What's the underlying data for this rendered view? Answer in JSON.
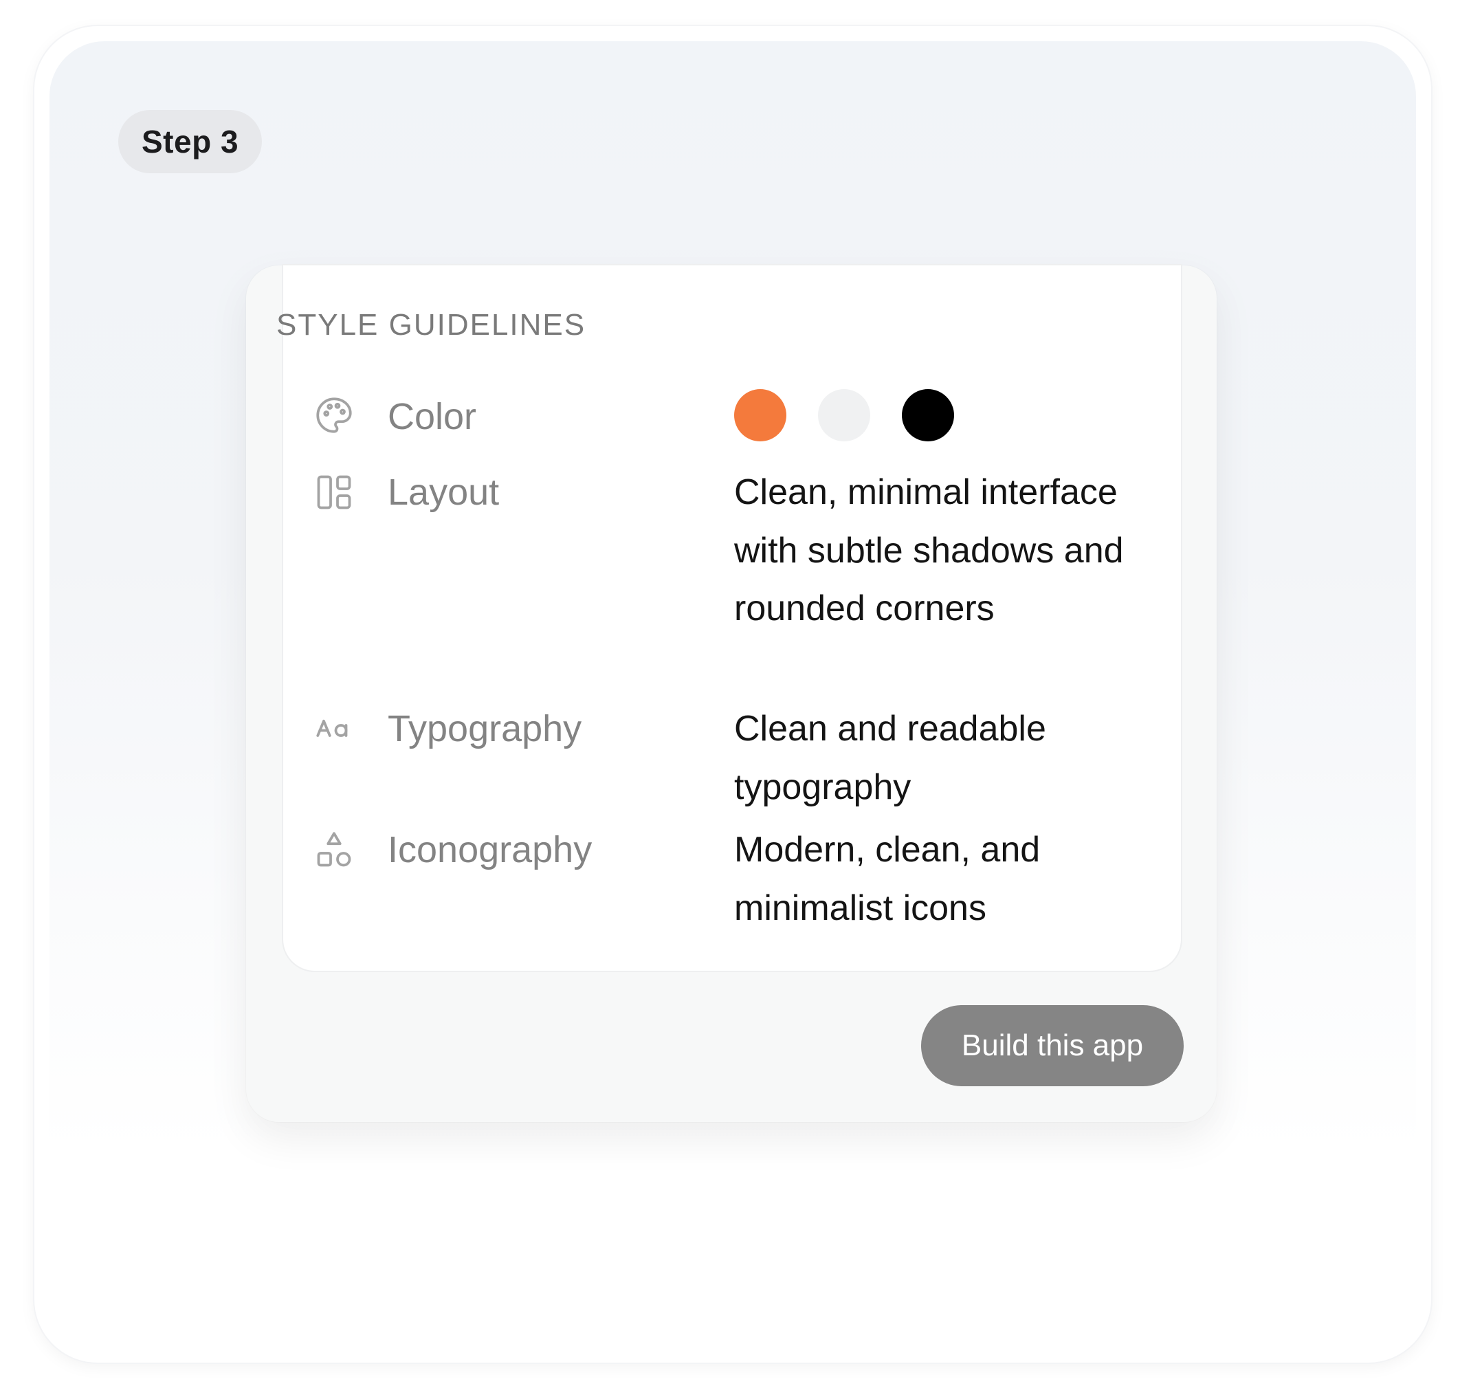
{
  "step_badge": "Step 3",
  "section_title": "STYLE GUIDELINES",
  "rows": [
    {
      "icon": "palette-icon",
      "label": "Color",
      "value": ""
    },
    {
      "icon": "layout-icon",
      "label": "Layout",
      "value": "Clean, minimal interface with subtle shadows and rounded corners"
    },
    {
      "icon": "typography-icon",
      "label": "Typography",
      "value": "Clean and readable typography"
    },
    {
      "icon": "shapes-icon",
      "label": "Iconography",
      "value": "Modern, clean, and minimalist icons"
    }
  ],
  "color_swatches": [
    "#f47a3c",
    "#f0f1f2",
    "#000000"
  ],
  "build_button_label": "Build this app"
}
